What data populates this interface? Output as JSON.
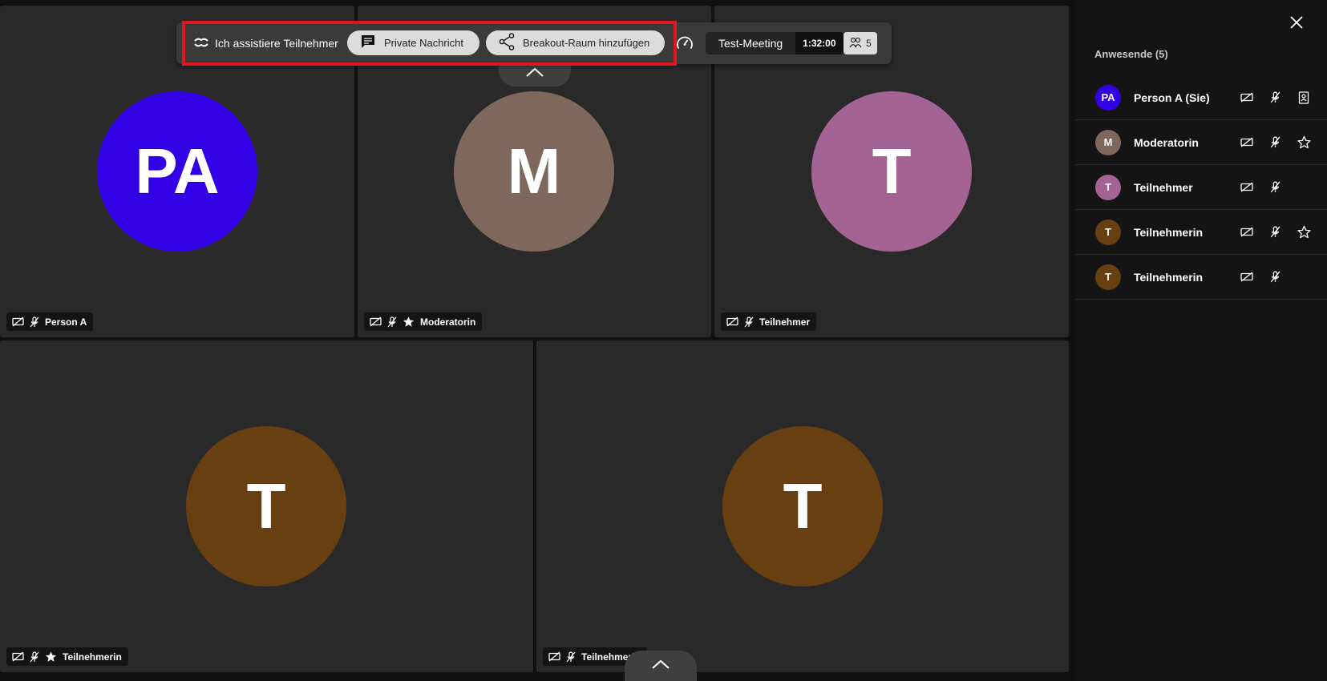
{
  "colors": {
    "highlight": "#e0151d",
    "tile_bg": "#292929",
    "avatar_pa": "#3300e6",
    "avatar_m": "#7e675c",
    "avatar_t_pink": "#a46395",
    "avatar_t_brown": "#683f10"
  },
  "toolbar": {
    "assist_label": "Ich assistiere Teilnehmer",
    "private_message_label": "Private Nachricht",
    "breakout_label": "Breakout-Raum hinzufügen",
    "meeting_title": "Test-Meeting",
    "timer": "1:32:00",
    "participants_count": "5"
  },
  "tiles": [
    {
      "initials": "PA",
      "name": "Person A",
      "color": "#3300e6",
      "star": false
    },
    {
      "initials": "M",
      "name": "Moderatorin",
      "color": "#7e675c",
      "star": true
    },
    {
      "initials": "T",
      "name": "Teilnehmer",
      "color": "#a46395",
      "star": false
    },
    {
      "initials": "T",
      "name": "Teilnehmerin",
      "color": "#683f10",
      "star": true
    },
    {
      "initials": "T",
      "name": "Teilnehmerin",
      "color": "#683f10",
      "star": false
    }
  ],
  "sidebar": {
    "heading": "Anwesende (5)",
    "attendees": [
      {
        "initials": "PA",
        "name": "Person A (Sie)",
        "color": "#3300e6",
        "extra_icon": "contact-card-icon"
      },
      {
        "initials": "M",
        "name": "Moderatorin",
        "color": "#7e675c",
        "extra_icon": "star-outline-icon"
      },
      {
        "initials": "T",
        "name": "Teilnehmer",
        "color": "#a46395",
        "extra_icon": ""
      },
      {
        "initials": "T",
        "name": "Teilnehmerin",
        "color": "#683f10",
        "extra_icon": "star-outline-icon"
      },
      {
        "initials": "T",
        "name": "Teilnehmerin",
        "color": "#683f10",
        "extra_icon": ""
      }
    ]
  }
}
